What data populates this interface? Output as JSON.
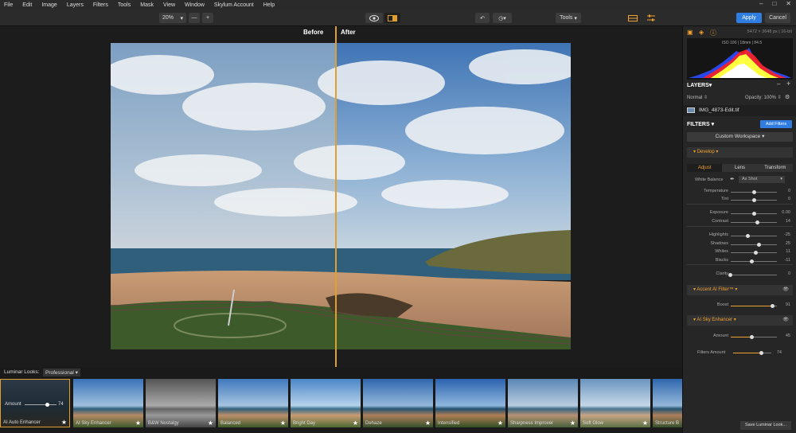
{
  "menu": [
    "File",
    "Edit",
    "Image",
    "Layers",
    "Filters",
    "Tools",
    "Mask",
    "View",
    "Window",
    "Skylum Account",
    "Help"
  ],
  "toolbar": {
    "zoom": "20%",
    "zoom_minus": "—",
    "zoom_plus": "+",
    "tools": "Tools",
    "apply": "Apply",
    "cancel": "Cancel"
  },
  "canvas": {
    "before": "Before",
    "after": "After"
  },
  "looks": {
    "label": "Luminar Looks:",
    "category": "Professional",
    "items": [
      {
        "name": "AI Auto Enhancer",
        "amount_label": "Amount",
        "amount": "74"
      },
      {
        "name": "AI Sky Enhancer"
      },
      {
        "name": "B&W Nostalgy"
      },
      {
        "name": "Balanced"
      },
      {
        "name": "Bright Day"
      },
      {
        "name": "Dehaze"
      },
      {
        "name": "Intensified"
      },
      {
        "name": "Sharpness Improver"
      },
      {
        "name": "Soft Glow"
      },
      {
        "name": "Structure B"
      }
    ],
    "save": "Save Luminar Look..."
  },
  "panel": {
    "file_info": "5472 × 3648 px  |  16-bit",
    "exif": "ISO 100  |  18mm  |  f/4.5",
    "layers_title": "LAYERS",
    "blend": "Normal",
    "opacity": "Opacity: 100%",
    "layer_name": "IMG_4873-Edit.tif",
    "filters_title": "FILTERS",
    "add_filters": "Add Filters",
    "workspace": "Custom Workspace",
    "develop": "Develop",
    "tabs": [
      "Adjust",
      "Lens",
      "Transform"
    ],
    "white_balance_label": "White Balance",
    "white_balance_value": "As Shot",
    "accent": "Accent AI Filter™",
    "sky": "AI Sky Enhancer",
    "filters_amount_label": "Filters Amount",
    "filters_amount": "74"
  },
  "sliders": [
    {
      "label": "Temperature",
      "value": "0",
      "pos": 0.5
    },
    {
      "label": "Tint",
      "value": "0",
      "pos": 0.5
    },
    {
      "label": "Exposure",
      "value": "0.00",
      "pos": 0.5
    },
    {
      "label": "Contrast",
      "value": "14",
      "pos": 0.57
    },
    {
      "label": "Highlights",
      "value": "-25",
      "pos": 0.37
    },
    {
      "label": "Shadows",
      "value": "25",
      "pos": 0.62
    },
    {
      "label": "Whites",
      "value": "11",
      "pos": 0.55
    },
    {
      "label": "Blacks",
      "value": "-11",
      "pos": 0.45
    },
    {
      "label": "Clarity",
      "value": "0",
      "pos": 0.02
    },
    {
      "label": "Boost",
      "value": "91",
      "pos": 0.91
    },
    {
      "label": "Amount",
      "value": "45",
      "pos": 0.45
    }
  ],
  "colors": {
    "accent": "#f0a030",
    "blue": "#2f7de1"
  }
}
